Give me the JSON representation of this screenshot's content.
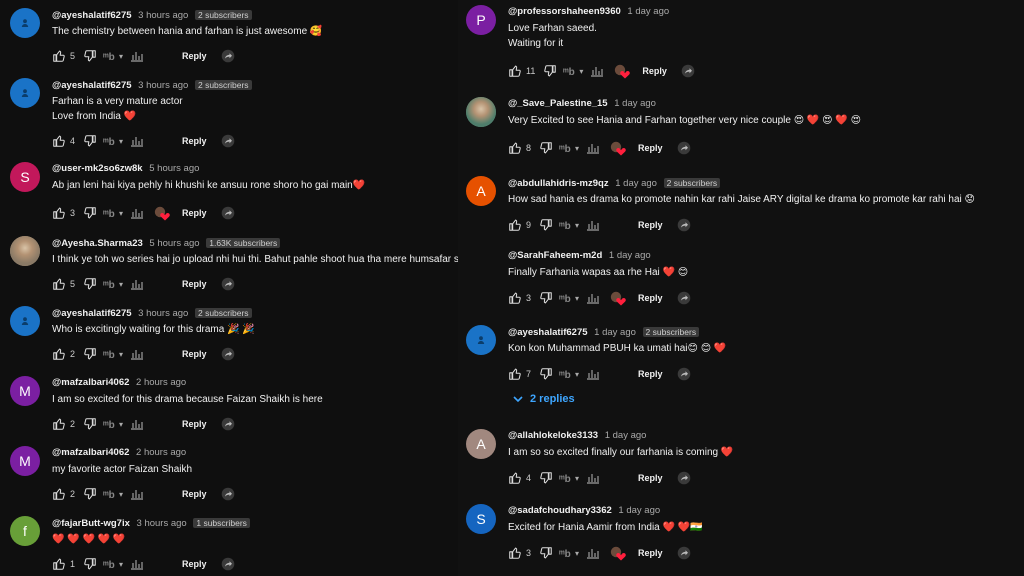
{
  "left": [
    {
      "author": "@ayeshalatif6275",
      "time": "3 hours ago",
      "badge": "2 subscribers",
      "lines": [
        "The chemistry between hania and farhan is just awesome 🥰"
      ],
      "likes": "5",
      "loved": false,
      "avatar": {
        "type": "icon",
        "color": "#1a73c7"
      }
    },
    {
      "author": "@ayeshalatif6275",
      "time": "3 hours ago",
      "badge": "2 subscribers",
      "lines": [
        "Farhan is a very mature actor",
        "Love from India ❤️"
      ],
      "likes": "4",
      "loved": false,
      "avatar": {
        "type": "icon",
        "color": "#1a73c7"
      }
    },
    {
      "author": "@user-mk2so6zw8k",
      "time": "5 hours ago",
      "badge": "",
      "lines": [
        "Ab jan leni hai kiya pehly hi khushi ke ansuu rone shoro ho gai main❤️"
      ],
      "likes": "3",
      "loved": true,
      "avatar": {
        "type": "letter",
        "letter": "S",
        "color": "#c2185b"
      }
    },
    {
      "author": "@Ayesha.Sharma23",
      "time": "5 hours ago",
      "badge": "1.63K subscribers",
      "lines": [
        "I think ye toh wo  series  hai jo upload nhi hui thi. Bahut pahle shoot hua tha mere humsafar se phle"
      ],
      "likes": "5",
      "loved": false,
      "avatar": {
        "type": "photo",
        "color": "#8a7a66"
      }
    },
    {
      "author": "@ayeshalatif6275",
      "time": "3 hours ago",
      "badge": "2 subscribers",
      "lines": [
        "Who is excitingly waiting for this drama 🎉 🎉"
      ],
      "likes": "2",
      "loved": false,
      "avatar": {
        "type": "icon",
        "color": "#1a73c7"
      }
    },
    {
      "author": "@mafzalbari4062",
      "time": "2 hours ago",
      "badge": "",
      "lines": [
        "I am so excited for this drama because Faizan Shaikh is here"
      ],
      "likes": "2",
      "loved": false,
      "avatar": {
        "type": "letter",
        "letter": "M",
        "color": "#7b1fa2"
      }
    },
    {
      "author": "@mafzalbari4062",
      "time": "2 hours ago",
      "badge": "",
      "lines": [
        "my favorite actor Faizan Shaikh"
      ],
      "likes": "2",
      "loved": false,
      "avatar": {
        "type": "letter",
        "letter": "M",
        "color": "#7b1fa2"
      }
    },
    {
      "author": "@fajarButt-wg7ix",
      "time": "3 hours ago",
      "badge": "1 subscribers",
      "lines": [
        "❤️ ❤️ ❤️ ❤️ ❤️"
      ],
      "likes": "1",
      "loved": false,
      "avatar": {
        "type": "letter",
        "letter": "f",
        "color": "#689f38"
      }
    }
  ],
  "right": [
    {
      "author": "@professorshaheen9360",
      "time": "1 day ago",
      "badge": "",
      "lines": [
        "Love Farhan saeed.",
        "Waiting for it"
      ],
      "likes": "11",
      "loved": true,
      "avatar": {
        "type": "letter",
        "letter": "P",
        "color": "#7b1fa2"
      }
    },
    {
      "author": "@_Save_Palestine_15",
      "time": "1 day ago",
      "badge": "",
      "lines": [
        "Very Excited to see Hania and Farhan together very nice couple 😍 ❤️ 😍 ❤️ 😍"
      ],
      "likes": "8",
      "loved": true,
      "avatar": {
        "type": "photo",
        "color": "#4e7d6b"
      }
    },
    {
      "author": "@abdullahidris-mz9qz",
      "time": "1 day ago",
      "badge": "2 subscribers",
      "lines": [
        "How sad hania es drama ko promote nahin kar rahi Jaise ARY digital ke drama ko promote kar rahi hai 😟"
      ],
      "likes": "9",
      "loved": false,
      "avatar": {
        "type": "letter",
        "letter": "A",
        "color": "#e65100"
      }
    },
    {
      "author": "@SarahFaheem-m2d",
      "time": "1 day ago",
      "badge": "",
      "lines": [
        "Finally Farhania wapas  aa rhe Hai ❤️ 😊"
      ],
      "likes": "3",
      "loved": true,
      "avatar": {
        "type": "none",
        "color": "#111"
      }
    },
    {
      "author": "@ayeshalatif6275",
      "time": "1 day ago",
      "badge": "2 subscribers",
      "lines": [
        "Kon kon Muhammad PBUH ka umati hai😊 😊 ❤️"
      ],
      "likes": "7",
      "loved": false,
      "avatar": {
        "type": "icon",
        "color": "#1a73c7"
      }
    },
    {
      "author": "@allahlokeloke3133",
      "time": "1 day ago",
      "badge": "",
      "lines": [
        "I am so so excited finally our farhania is coming ❤️"
      ],
      "likes": "4",
      "loved": false,
      "avatar": {
        "type": "letter",
        "letter": "A",
        "color": "#a1887f"
      }
    },
    {
      "author": "@sadafchoudhary3362",
      "time": "1 day ago",
      "badge": "",
      "lines": [
        "Excited for Hania Aamir from India ❤️ ❤️🇮🇳"
      ],
      "likes": "3",
      "loved": true,
      "avatar": {
        "type": "letter",
        "letter": "S",
        "color": "#1565c0"
      }
    }
  ],
  "replies_label": "2 replies",
  "reply_label": "Reply",
  "icons": {
    "like": "thumbs-up-icon",
    "dislike": "thumbs-down-icon",
    "subscript": "mb-icon",
    "stats": "bar-chart-icon",
    "share": "share-icon",
    "heart": "heart-icon"
  }
}
